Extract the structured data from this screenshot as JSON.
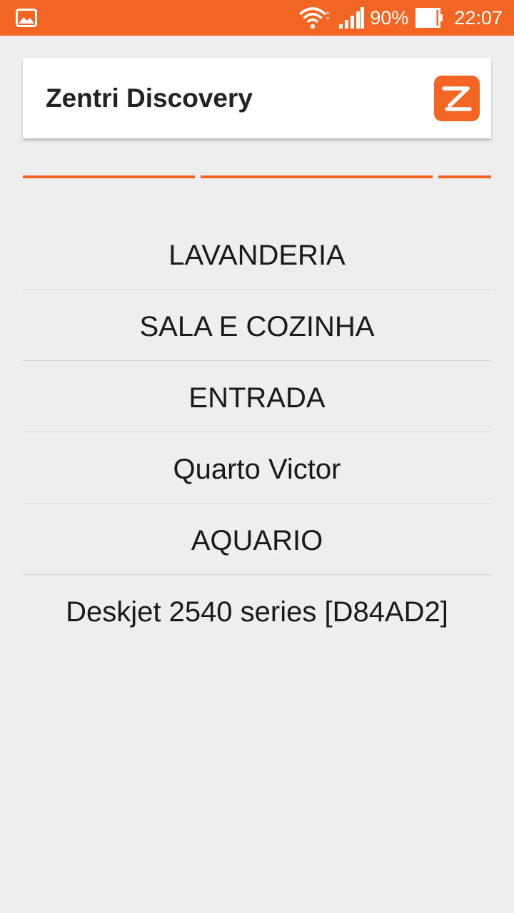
{
  "status_bar": {
    "notification_icon": "image-icon",
    "wifi_icon": "wifi-icon",
    "signal_icon": "signal-icon",
    "battery_percent": "90%",
    "battery_icon": "battery-icon",
    "time": "22:07"
  },
  "app_bar": {
    "title": "Zentri Discovery",
    "logo_icon": "zentri-logo-icon"
  },
  "colors": {
    "accent": "#f26522",
    "background": "#eeeeee",
    "surface": "#ffffff",
    "text": "#1a1a1a"
  },
  "devices": [
    {
      "label": "LAVANDERIA"
    },
    {
      "label": "SALA E COZINHA"
    },
    {
      "label": "ENTRADA"
    },
    {
      "label": "Quarto Victor"
    },
    {
      "label": "AQUARIO"
    },
    {
      "label": "Deskjet 2540 series [D84AD2]"
    }
  ]
}
